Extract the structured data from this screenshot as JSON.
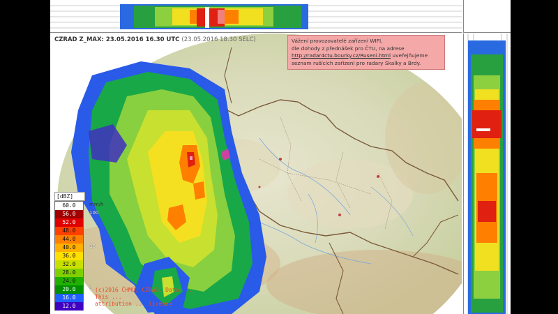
{
  "header": {
    "product": "CZRAD Z_MAX: 23.05.2016 16.30 UTC",
    "local_time": "(23.05.2016 18.30 SELC)"
  },
  "notice": {
    "line1": "Vážení provozovatelé zařízení WIFI,",
    "line2": "dle dohody z přednášek pro ČTU, na adrese",
    "link": "http://radar4ctu.bourky.cz/Ruseni.html",
    "line3_suffix": " uveřejňujeme",
    "line4": "seznam rušících zařízení pro radary Skalky a Brdy."
  },
  "legend": {
    "title": "[dBZ]",
    "unit_label": "mm/h",
    "levels": [
      {
        "dbz": "60.0",
        "color": "#ffffff"
      },
      {
        "dbz": "56.0",
        "color": "#a00000"
      },
      {
        "dbz": "52.0",
        "color": "#e00000"
      },
      {
        "dbz": "48.0",
        "color": "#ff4000"
      },
      {
        "dbz": "44.0",
        "color": "#ff8000"
      },
      {
        "dbz": "40.0",
        "color": "#ffb000"
      },
      {
        "dbz": "36.0",
        "color": "#ffe000"
      },
      {
        "dbz": "32.0",
        "color": "#c8e000"
      },
      {
        "dbz": "28.0",
        "color": "#80d000"
      },
      {
        "dbz": "24.0",
        "color": "#20b000"
      },
      {
        "dbz": "20.0",
        "color": "#009000"
      },
      {
        "dbz": "16.0",
        "color": "#2060ff"
      },
      {
        "dbz": "12.0",
        "color": "#4000c0"
      }
    ],
    "rates": [
      {
        "label": "100",
        "row": 1
      },
      {
        "label": "10",
        "row": 5
      },
      {
        "label": "1",
        "row": 10
      }
    ]
  },
  "copyright": {
    "line1": "(c)2016 ČHMÚ, CZRAD. Data ...",
    "line2": "This ...",
    "line3": "attribution ... license"
  }
}
